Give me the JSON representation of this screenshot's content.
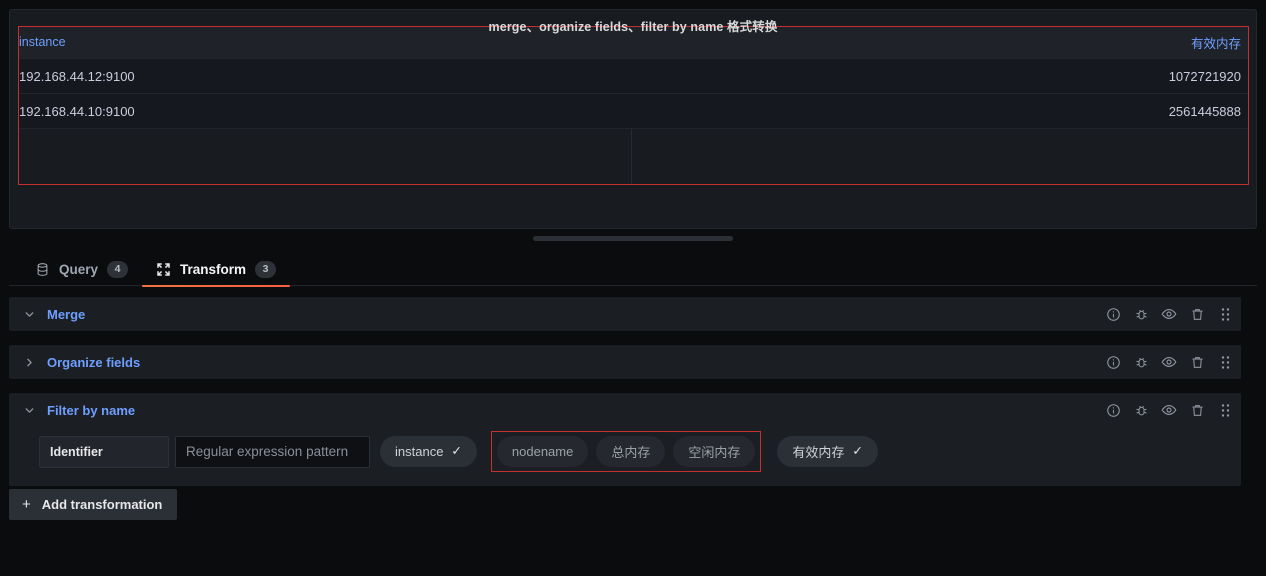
{
  "panel": {
    "title": "merge、organize fields、filter by name 格式转换",
    "annotation_color": "#c43030"
  },
  "table": {
    "columns": [
      "instance",
      "有效内存"
    ],
    "rows": [
      {
        "instance": "192.168.44.12:9100",
        "value": "1072721920"
      },
      {
        "instance": "192.168.44.10:9100",
        "value": "2561445888"
      }
    ]
  },
  "tabs": [
    {
      "label": "Query",
      "badge": "4",
      "icon": "database-icon",
      "active": false
    },
    {
      "label": "Transform",
      "badge": "3",
      "icon": "process-icon",
      "active": true
    }
  ],
  "transformations": [
    {
      "name": "Merge",
      "expanded": true
    },
    {
      "name": "Organize fields",
      "expanded": false
    },
    {
      "name": "Filter by name",
      "expanded": true
    }
  ],
  "row_actions": [
    {
      "name": "info-icon",
      "label": "Show transform help"
    },
    {
      "name": "bug-icon",
      "label": "Debug"
    },
    {
      "name": "eye-icon",
      "label": "Disable transformation"
    },
    {
      "name": "trash-icon",
      "label": "Remove transformation"
    },
    {
      "name": "drag-handle-icon",
      "label": "Drag and drop to reorder"
    }
  ],
  "filter_by_name": {
    "identifier_label": "Identifier",
    "regex_placeholder": "Regular expression pattern",
    "regex_value": "",
    "selected_field_pill": {
      "label": "instance",
      "selected": true
    },
    "available_fields": [
      {
        "label": "nodename",
        "selected": false
      },
      {
        "label": "总内存",
        "selected": false
      },
      {
        "label": "空闲内存",
        "selected": false
      }
    ],
    "selected_field_outside": {
      "label": "有效内存",
      "selected": true
    },
    "checkmark": "✓"
  },
  "add_transformation": {
    "label": "Add transformation",
    "plus": "+"
  }
}
